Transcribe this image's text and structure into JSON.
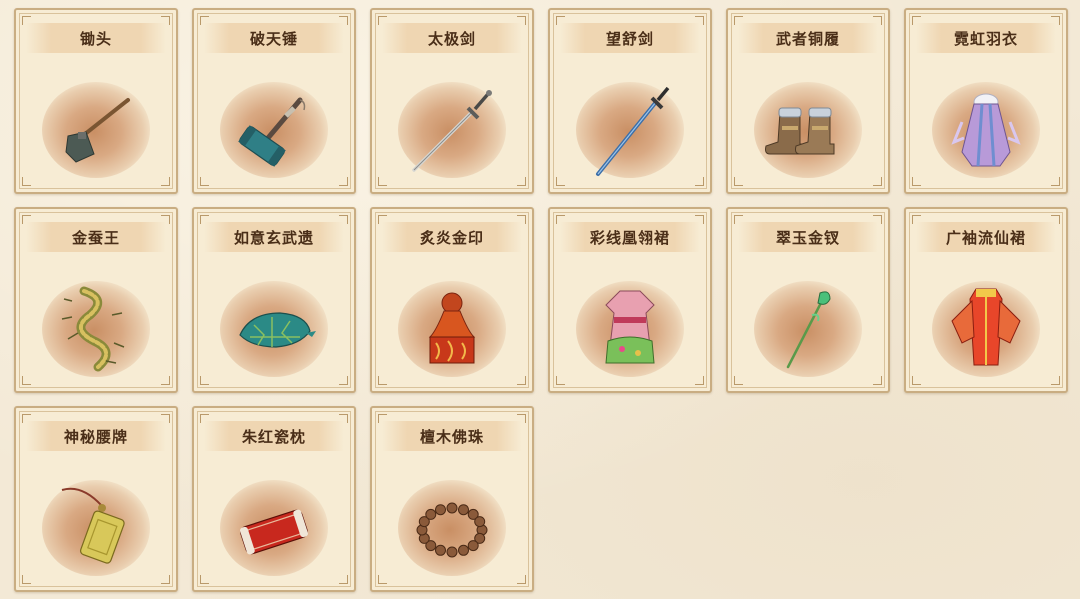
{
  "items": [
    {
      "name": "锄头",
      "icon": "hoe-icon"
    },
    {
      "name": "破天锤",
      "icon": "hammer-icon"
    },
    {
      "name": "太极剑",
      "icon": "sword-icon"
    },
    {
      "name": "望舒剑",
      "icon": "blue-sword-icon"
    },
    {
      "name": "武者铜履",
      "icon": "boots-icon"
    },
    {
      "name": "霓虹羽衣",
      "icon": "feather-robe-icon"
    },
    {
      "name": "金蚕王",
      "icon": "golden-silkworm-icon"
    },
    {
      "name": "如意玄武遗",
      "icon": "tortoise-shell-icon"
    },
    {
      "name": "炙炎金印",
      "icon": "fire-seal-icon"
    },
    {
      "name": "彩线凰翎裙",
      "icon": "phoenix-dress-icon"
    },
    {
      "name": "翠玉金钗",
      "icon": "jade-hairpin-icon"
    },
    {
      "name": "广袖流仙裙",
      "icon": "immortal-dress-icon"
    },
    {
      "name": "神秘腰牌",
      "icon": "waist-token-icon"
    },
    {
      "name": "朱红瓷枕",
      "icon": "porcelain-pillow-icon"
    },
    {
      "name": "檀木佛珠",
      "icon": "prayer-beads-icon"
    }
  ]
}
